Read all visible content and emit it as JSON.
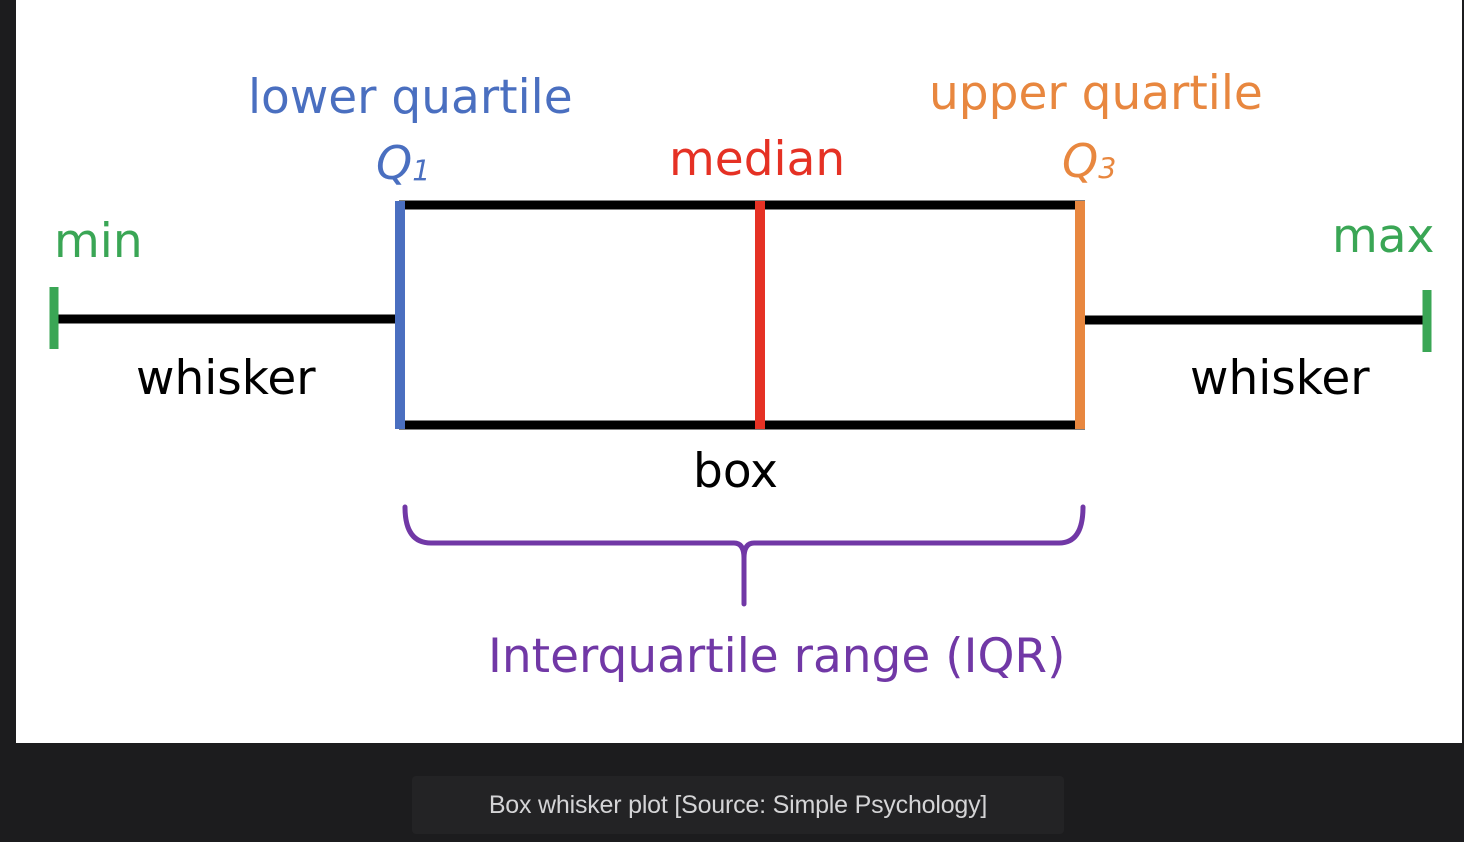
{
  "diagram": {
    "labels": {
      "lower_quartile": "lower quartile",
      "q1_letter": "Q",
      "q1_index": "1",
      "median": "median",
      "upper_quartile": "upper quartile",
      "q3_letter": "Q",
      "q3_index": "3",
      "min": "min",
      "max": "max",
      "whisker_left": "whisker",
      "whisker_right": "whisker",
      "box": "box",
      "iqr": "Interquartile range (IQR)"
    },
    "colors": {
      "min_max": "#3aa655",
      "q1": "#4a6fc0",
      "median": "#e53124",
      "q3": "#e8873f",
      "iqr": "#7138a6",
      "text": "#000000",
      "line": "#000000"
    }
  },
  "caption": "Box whisker plot [Source: Simple Psychology]"
}
